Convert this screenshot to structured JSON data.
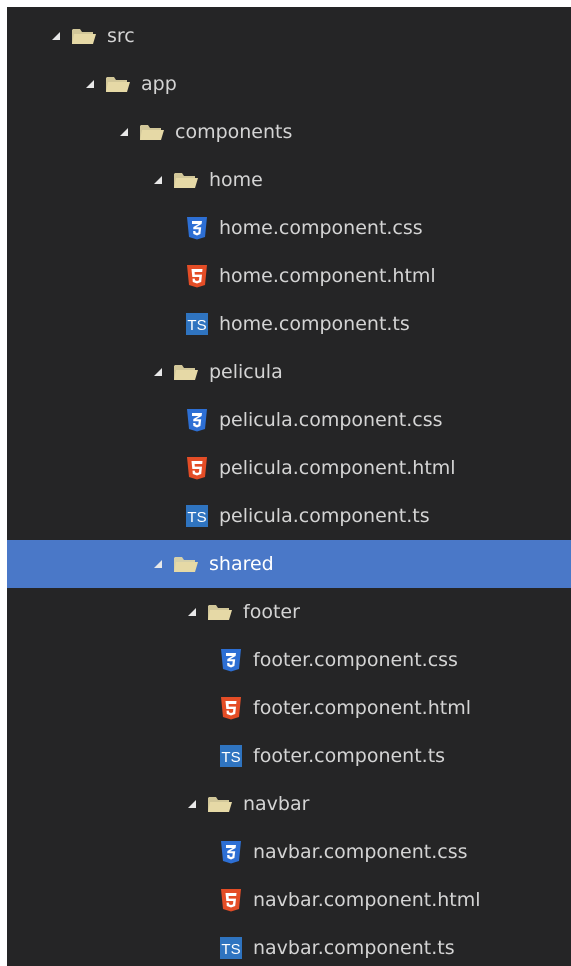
{
  "tree": [
    {
      "label": "src",
      "type": "folder",
      "depth": 0,
      "expanded": true,
      "selected": false,
      "icon": "folder-open-icon"
    },
    {
      "label": "app",
      "type": "folder",
      "depth": 1,
      "expanded": true,
      "selected": false,
      "icon": "folder-open-icon"
    },
    {
      "label": "components",
      "type": "folder",
      "depth": 2,
      "expanded": true,
      "selected": false,
      "icon": "folder-open-icon"
    },
    {
      "label": "home",
      "type": "folder",
      "depth": 3,
      "expanded": true,
      "selected": false,
      "icon": "folder-open-icon"
    },
    {
      "label": "home.component.css",
      "type": "css",
      "depth": 4,
      "selected": false,
      "icon": "css3-icon"
    },
    {
      "label": "home.component.html",
      "type": "html",
      "depth": 4,
      "selected": false,
      "icon": "html5-icon"
    },
    {
      "label": "home.component.ts",
      "type": "ts",
      "depth": 4,
      "selected": false,
      "icon": "typescript-icon"
    },
    {
      "label": "pelicula",
      "type": "folder",
      "depth": 3,
      "expanded": true,
      "selected": false,
      "icon": "folder-open-icon"
    },
    {
      "label": "pelicula.component.css",
      "type": "css",
      "depth": 4,
      "selected": false,
      "icon": "css3-icon"
    },
    {
      "label": "pelicula.component.html",
      "type": "html",
      "depth": 4,
      "selected": false,
      "icon": "html5-icon"
    },
    {
      "label": "pelicula.component.ts",
      "type": "ts",
      "depth": 4,
      "selected": false,
      "icon": "typescript-icon"
    },
    {
      "label": "shared",
      "type": "folder",
      "depth": 3,
      "expanded": true,
      "selected": true,
      "icon": "folder-open-icon"
    },
    {
      "label": "footer",
      "type": "folder",
      "depth": 4,
      "expanded": true,
      "selected": false,
      "icon": "folder-open-icon"
    },
    {
      "label": "footer.component.css",
      "type": "css",
      "depth": 5,
      "selected": false,
      "icon": "css3-icon"
    },
    {
      "label": "footer.component.html",
      "type": "html",
      "depth": 5,
      "selected": false,
      "icon": "html5-icon"
    },
    {
      "label": "footer.component.ts",
      "type": "ts",
      "depth": 5,
      "selected": false,
      "icon": "typescript-icon"
    },
    {
      "label": "navbar",
      "type": "folder",
      "depth": 4,
      "expanded": true,
      "selected": false,
      "icon": "folder-open-icon"
    },
    {
      "label": "navbar.component.css",
      "type": "css",
      "depth": 5,
      "selected": false,
      "icon": "css3-icon"
    },
    {
      "label": "navbar.component.html",
      "type": "html",
      "depth": 5,
      "selected": false,
      "icon": "html5-icon"
    },
    {
      "label": "navbar.component.ts",
      "type": "ts",
      "depth": 5,
      "selected": false,
      "icon": "typescript-icon"
    }
  ],
  "colors": {
    "panel_background": "#252526",
    "text": "#d4d4d4",
    "selection": "#4a78c8",
    "folder": "#e6d9a6",
    "css": "#2d6fd4",
    "html": "#e44d26",
    "ts": "#2f74c0"
  }
}
